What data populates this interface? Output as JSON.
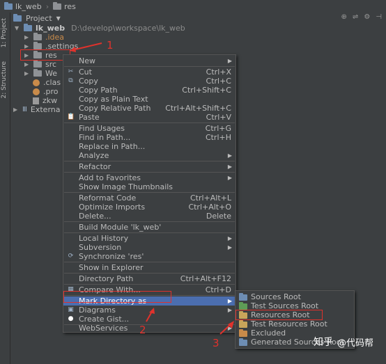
{
  "breadcrumb": {
    "project": "lk_web",
    "folder": "res"
  },
  "side_tabs": {
    "project": "1: Project",
    "structure": "2: Structure"
  },
  "panel": {
    "title": "Project"
  },
  "tree": {
    "root_name": "lk_web",
    "root_path": "D:\\develop\\workspace\\lk_web",
    "items": [
      {
        "label": ".idea"
      },
      {
        "label": ".settings"
      },
      {
        "label": "res"
      },
      {
        "label": "src"
      },
      {
        "label": "We"
      },
      {
        "label": ".clas"
      },
      {
        "label": ".pro"
      },
      {
        "label": "zkw"
      }
    ],
    "external": "Externa"
  },
  "context_menu": {
    "items": [
      {
        "label": "New",
        "shortcut": ""
      },
      {
        "label": "Cut",
        "shortcut": "Ctrl+X"
      },
      {
        "label": "Copy",
        "shortcut": "Ctrl+C"
      },
      {
        "label": "Copy Path",
        "shortcut": "Ctrl+Shift+C"
      },
      {
        "label": "Copy as Plain Text",
        "shortcut": ""
      },
      {
        "label": "Copy Relative Path",
        "shortcut": "Ctrl+Alt+Shift+C"
      },
      {
        "label": "Paste",
        "shortcut": "Ctrl+V"
      },
      {
        "label": "Find Usages",
        "shortcut": "Ctrl+G"
      },
      {
        "label": "Find in Path...",
        "shortcut": "Ctrl+H"
      },
      {
        "label": "Replace in Path...",
        "shortcut": ""
      },
      {
        "label": "Analyze",
        "shortcut": ""
      },
      {
        "label": "Refactor",
        "shortcut": ""
      },
      {
        "label": "Add to Favorites",
        "shortcut": ""
      },
      {
        "label": "Show Image Thumbnails",
        "shortcut": ""
      },
      {
        "label": "Reformat Code",
        "shortcut": "Ctrl+Alt+L"
      },
      {
        "label": "Optimize Imports",
        "shortcut": "Ctrl+Alt+O"
      },
      {
        "label": "Delete...",
        "shortcut": "Delete"
      },
      {
        "label": "Build Module 'lk_web'",
        "shortcut": ""
      },
      {
        "label": "Local History",
        "shortcut": ""
      },
      {
        "label": "Subversion",
        "shortcut": ""
      },
      {
        "label": "Synchronize 'res'",
        "shortcut": ""
      },
      {
        "label": "Show in Explorer",
        "shortcut": ""
      },
      {
        "label": "Directory Path",
        "shortcut": "Ctrl+Alt+F12"
      },
      {
        "label": "Compare With...",
        "shortcut": "Ctrl+D"
      },
      {
        "label": "Mark Directory as",
        "shortcut": ""
      },
      {
        "label": "Diagrams",
        "shortcut": ""
      },
      {
        "label": "Create Gist...",
        "shortcut": ""
      },
      {
        "label": "WebServices",
        "shortcut": ""
      }
    ]
  },
  "submenu": {
    "items": [
      {
        "label": "Sources Root"
      },
      {
        "label": "Test Sources Root"
      },
      {
        "label": "Resources Root"
      },
      {
        "label": "Test Resources Root"
      },
      {
        "label": "Excluded"
      },
      {
        "label": "Generated Sources Root"
      }
    ]
  },
  "annotations": {
    "one": "1",
    "two": "2",
    "three": "3"
  },
  "watermark": {
    "brand": "知乎",
    "handle": "@代码帮"
  },
  "colors": {
    "selection": "#4b6eaf",
    "annotation": "#e0322c"
  }
}
